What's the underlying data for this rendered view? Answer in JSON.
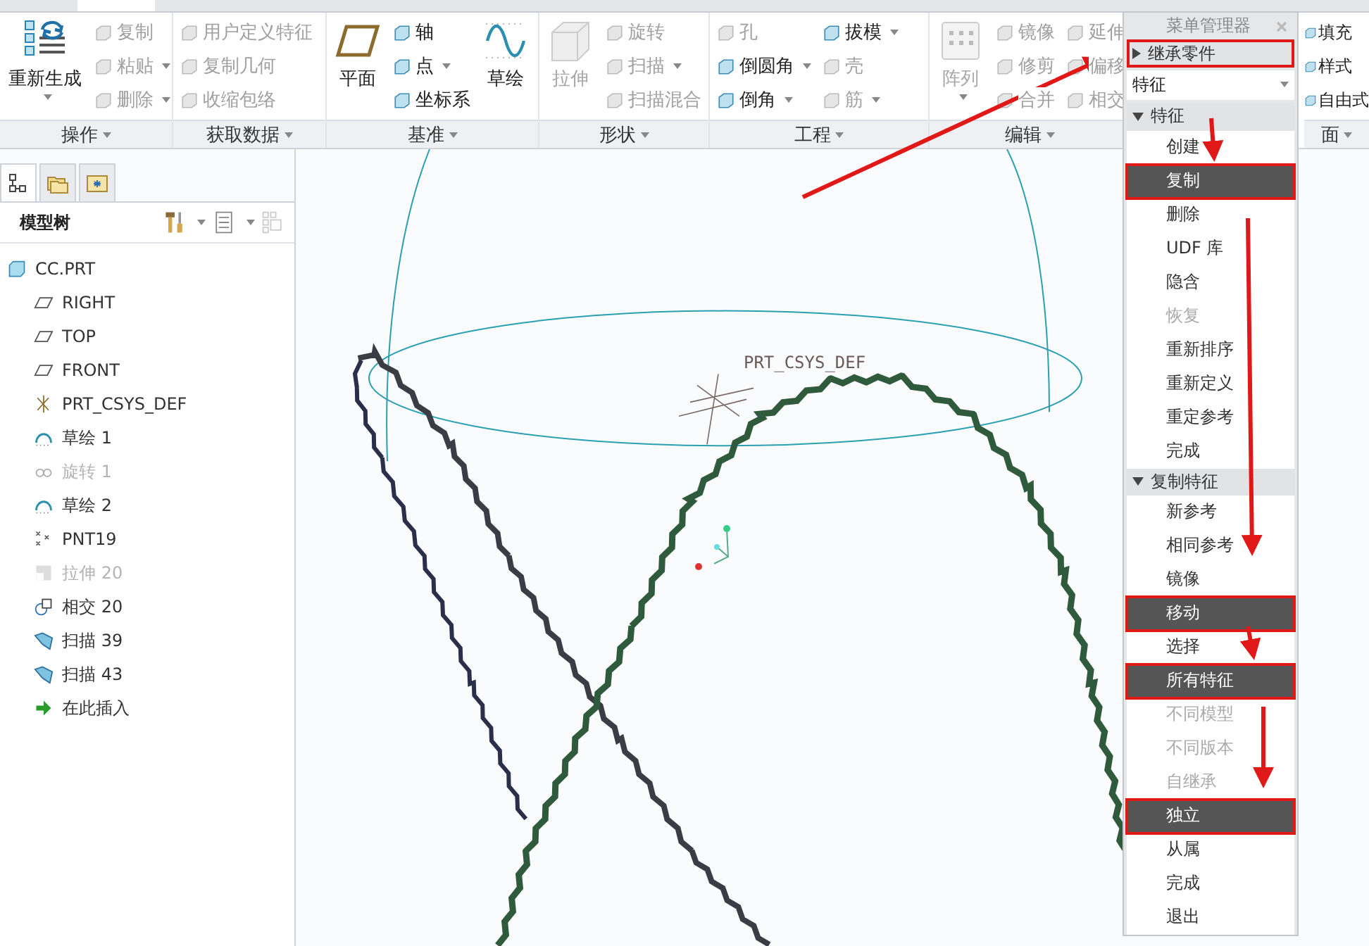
{
  "ribbon": {
    "groups": [
      {
        "label": "操作",
        "columns": [
          [
            {
              "label": "重新生成",
              "kind": "large",
              "disabled": false,
              "dropdown": true
            }
          ],
          [
            {
              "label": "复制",
              "kind": "small",
              "disabled": true,
              "dropdown": false
            },
            {
              "label": "粘贴",
              "kind": "small",
              "disabled": true,
              "dropdown": true
            },
            {
              "label": "删除",
              "kind": "small",
              "disabled": true,
              "dropdown": true
            }
          ]
        ]
      },
      {
        "label": "获取数据",
        "columns": [
          [
            {
              "label": "用户定义特征",
              "kind": "small",
              "disabled": true,
              "dropdown": false
            },
            {
              "label": "复制几何",
              "kind": "small",
              "disabled": true,
              "dropdown": false
            },
            {
              "label": "收缩包络",
              "kind": "small",
              "disabled": true,
              "dropdown": false
            }
          ]
        ]
      },
      {
        "label": "基准",
        "columns": [
          [
            {
              "label": "平面",
              "kind": "large",
              "disabled": false,
              "dropdown": false
            }
          ],
          [
            {
              "label": "轴",
              "kind": "small",
              "disabled": false,
              "dropdown": false
            },
            {
              "label": "点",
              "kind": "small",
              "disabled": false,
              "dropdown": true
            },
            {
              "label": "坐标系",
              "kind": "small",
              "disabled": false,
              "dropdown": false
            }
          ],
          [
            {
              "label": "草绘",
              "kind": "large",
              "disabled": false,
              "dropdown": false
            }
          ]
        ]
      },
      {
        "label": "形状",
        "columns": [
          [
            {
              "label": "拉伸",
              "kind": "large",
              "disabled": true,
              "dropdown": false
            }
          ],
          [
            {
              "label": "旋转",
              "kind": "small",
              "disabled": true,
              "dropdown": false
            },
            {
              "label": "扫描",
              "kind": "small",
              "disabled": true,
              "dropdown": true
            },
            {
              "label": "扫描混合",
              "kind": "small",
              "disabled": true,
              "dropdown": false
            }
          ]
        ]
      },
      {
        "label": "工程",
        "columns": [
          [
            {
              "label": "孔",
              "kind": "small",
              "disabled": true,
              "dropdown": false
            },
            {
              "label": "倒圆角",
              "kind": "small",
              "disabled": false,
              "dropdown": true
            },
            {
              "label": "倒角",
              "kind": "small",
              "disabled": false,
              "dropdown": true
            }
          ],
          [
            {
              "label": "拔模",
              "kind": "small",
              "disabled": false,
              "dropdown": true
            },
            {
              "label": "壳",
              "kind": "small",
              "disabled": true,
              "dropdown": false
            },
            {
              "label": "筋",
              "kind": "small",
              "disabled": true,
              "dropdown": true
            }
          ]
        ]
      },
      {
        "label": "编辑",
        "columns": [
          [
            {
              "label": "阵列",
              "kind": "large",
              "disabled": true,
              "dropdown": true
            }
          ],
          [
            {
              "label": "镜像",
              "kind": "small",
              "disabled": true,
              "dropdown": false
            },
            {
              "label": "修剪",
              "kind": "small",
              "disabled": true,
              "dropdown": false
            },
            {
              "label": "合并",
              "kind": "small",
              "disabled": true,
              "dropdown": false
            }
          ],
          [
            {
              "label": "延伸",
              "kind": "small",
              "disabled": true,
              "dropdown": false
            },
            {
              "label": "偏移",
              "kind": "small",
              "disabled": true,
              "dropdown": false
            },
            {
              "label": "相交",
              "kind": "small",
              "disabled": true,
              "dropdown": false
            }
          ]
        ]
      },
      {
        "label": "面",
        "columns": [
          [
            {
              "label": "填充",
              "kind": "small",
              "disabled": false,
              "dropdown": false
            },
            {
              "label": "样式",
              "kind": "small",
              "disabled": false,
              "dropdown": false
            },
            {
              "label": "自由式",
              "kind": "small",
              "disabled": false,
              "dropdown": false
            }
          ]
        ]
      }
    ]
  },
  "model_tree": {
    "tabs": [
      {
        "selected": true
      },
      {
        "selected": false
      },
      {
        "selected": false
      }
    ],
    "title": "模型树",
    "items": [
      {
        "label": "CC.PRT",
        "kind": "part",
        "disabled": false,
        "children": [
          {
            "label": "RIGHT",
            "kind": "plane",
            "disabled": false
          },
          {
            "label": "TOP",
            "kind": "plane",
            "disabled": false
          },
          {
            "label": "FRONT",
            "kind": "plane",
            "disabled": false
          },
          {
            "label": "PRT_CSYS_DEF",
            "kind": "csys",
            "disabled": false
          },
          {
            "label": "草绘 1",
            "kind": "sketch",
            "disabled": false
          },
          {
            "label": "旋转 1",
            "kind": "revolve",
            "disabled": true
          },
          {
            "label": "草绘 2",
            "kind": "sketch",
            "disabled": false
          },
          {
            "label": "PNT19",
            "kind": "point",
            "disabled": false
          },
          {
            "label": "拉伸 20",
            "kind": "extrude",
            "disabled": true
          },
          {
            "label": "相交 20",
            "kind": "intersect",
            "disabled": false
          },
          {
            "label": "扫描 39",
            "kind": "sweep",
            "disabled": false
          },
          {
            "label": "扫描 43",
            "kind": "sweep",
            "disabled": false
          },
          {
            "label": "在此插入",
            "kind": "insert",
            "disabled": false
          }
        ]
      }
    ]
  },
  "viewport": {
    "csys_label": "PRT_CSYS_DEF"
  },
  "menu_manager": {
    "title": "菜单管理器",
    "blocks": [
      {
        "kind": "section",
        "label": "继承零件",
        "expanded": false,
        "annotated": true
      },
      {
        "kind": "dropdown",
        "value": "特征"
      },
      {
        "kind": "section",
        "label": "特征",
        "expanded": true,
        "annotated": false,
        "items": [
          {
            "label": "创建",
            "selected": false,
            "disabled": false,
            "annotated": false
          },
          {
            "label": "复制",
            "selected": true,
            "disabled": false,
            "annotated": true
          },
          {
            "label": "删除",
            "selected": false,
            "disabled": false,
            "annotated": false
          },
          {
            "label": "UDF 库",
            "selected": false,
            "disabled": false,
            "annotated": false
          },
          {
            "label": "隐含",
            "selected": false,
            "disabled": false,
            "annotated": false
          },
          {
            "label": "恢复",
            "selected": false,
            "disabled": true,
            "annotated": false
          },
          {
            "label": "重新排序",
            "selected": false,
            "disabled": false,
            "annotated": false
          },
          {
            "label": "重新定义",
            "selected": false,
            "disabled": false,
            "annotated": false
          },
          {
            "label": "重定参考",
            "selected": false,
            "disabled": false,
            "annotated": false
          },
          {
            "label": "完成",
            "selected": false,
            "disabled": false,
            "annotated": false
          }
        ]
      },
      {
        "kind": "section",
        "label": "复制特征",
        "expanded": true,
        "annotated": false,
        "items": [
          {
            "label": "新参考",
            "selected": false,
            "disabled": false,
            "annotated": false
          },
          {
            "label": "相同参考",
            "selected": false,
            "disabled": false,
            "annotated": false
          },
          {
            "label": "镜像",
            "selected": false,
            "disabled": false,
            "annotated": false
          },
          {
            "label": "移动",
            "selected": true,
            "disabled": false,
            "annotated": true
          },
          {
            "label": "选择",
            "selected": false,
            "disabled": false,
            "annotated": false
          },
          {
            "label": "所有特征",
            "selected": true,
            "disabled": false,
            "annotated": true
          },
          {
            "label": "不同模型",
            "selected": false,
            "disabled": true,
            "annotated": false
          },
          {
            "label": "不同版本",
            "selected": false,
            "disabled": true,
            "annotated": false
          },
          {
            "label": "自继承",
            "selected": false,
            "disabled": true,
            "annotated": false
          },
          {
            "label": "独立",
            "selected": true,
            "disabled": false,
            "annotated": true
          },
          {
            "label": "从属",
            "selected": false,
            "disabled": false,
            "annotated": false
          },
          {
            "label": "完成",
            "selected": false,
            "disabled": false,
            "annotated": false
          },
          {
            "label": "退出",
            "selected": false,
            "disabled": false,
            "annotated": false
          }
        ]
      }
    ]
  }
}
